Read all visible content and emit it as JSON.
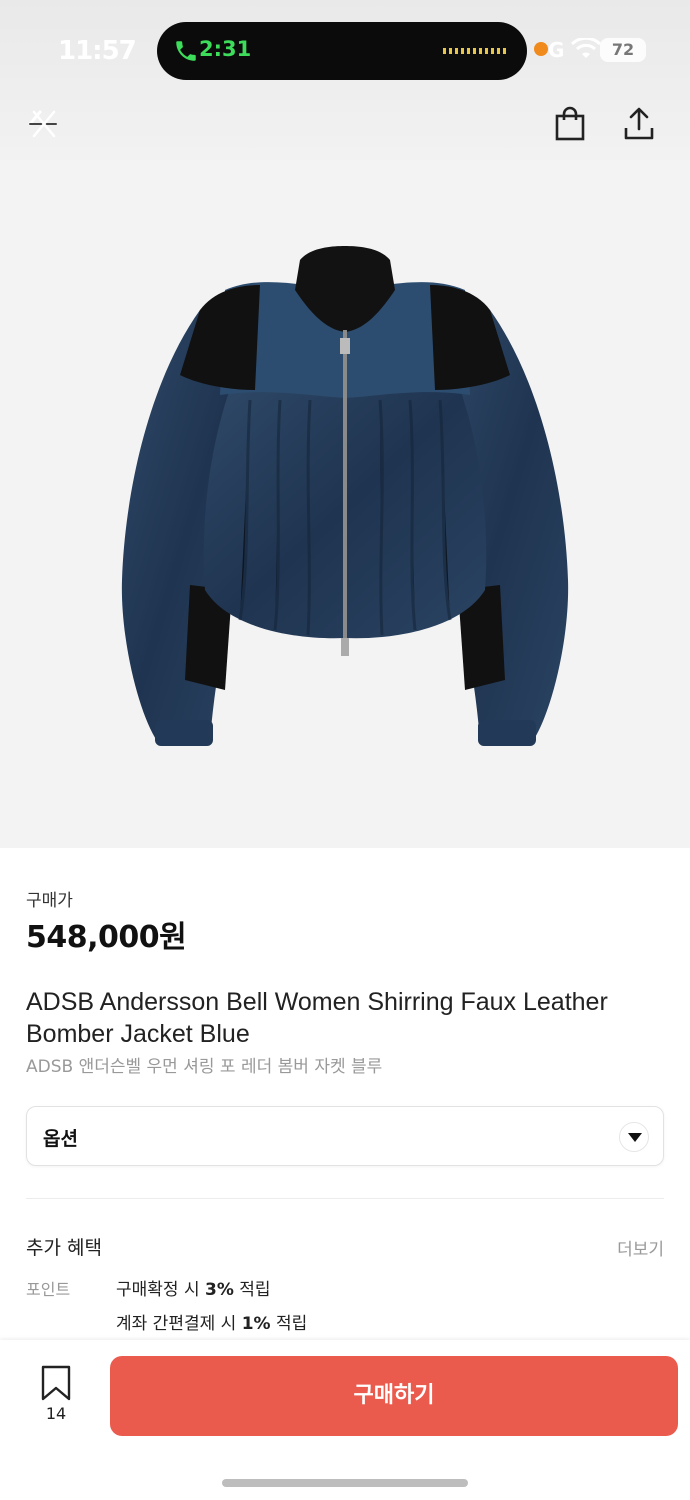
{
  "status_bar": {
    "time": "11:57",
    "call_time": "2:31",
    "network": "G",
    "battery": "72"
  },
  "header": {
    "back_icon": "back-arrow-icon",
    "bag_icon": "shopping-bag-icon",
    "share_icon": "share-icon"
  },
  "product": {
    "image": "blue faux leather bomber jacket",
    "price_label": "구매가",
    "price": "548,000원",
    "title": "ADSB Andersson Bell Women Shirring Faux Leather Bomber Jacket Blue",
    "subtitle": "ADSB 앤더슨벨 우먼 셔링 포 레더 봄버 자켓 블루"
  },
  "option": {
    "label": "옵션"
  },
  "benefits": {
    "title": "추가 혜택",
    "more": "더보기",
    "point_label": "포인트",
    "line1_pre": "구매확정 시 ",
    "line1_bold": "3%",
    "line1_post": " 적립",
    "line2_pre": "계좌 간편결제 시 ",
    "line2_bold": "1%",
    "line2_post": " 적립"
  },
  "bottom": {
    "bookmark_count": "14",
    "buy_label": "구매하기"
  },
  "colors": {
    "buy_button": "#eb5b4d",
    "call_green": "#3ddc5a"
  }
}
